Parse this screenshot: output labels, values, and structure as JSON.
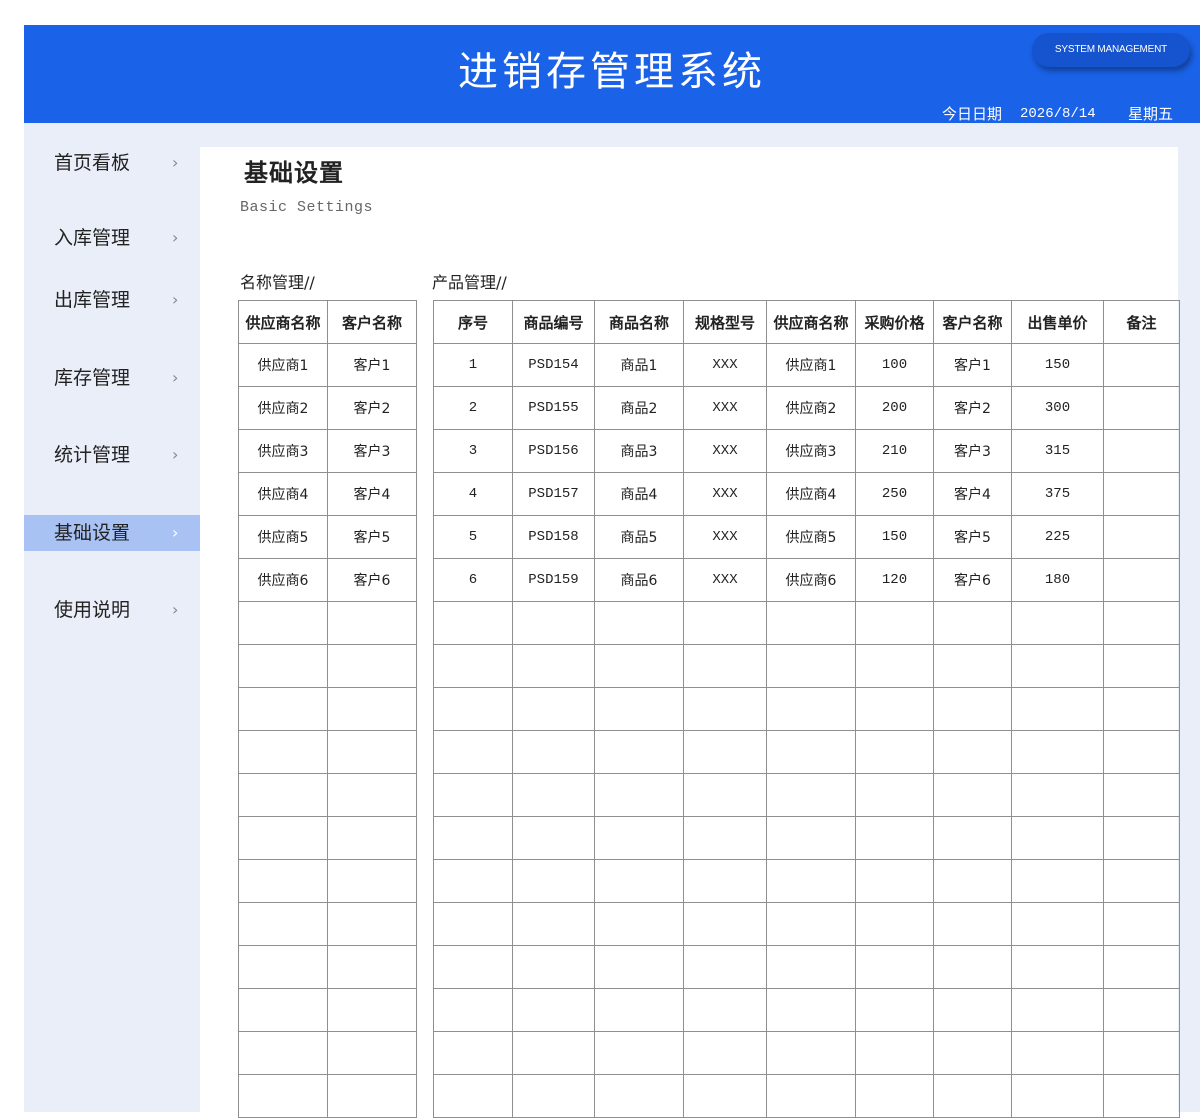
{
  "header": {
    "title": "进销存管理系统",
    "badge": "SYSTEM MANAGEMENT",
    "date_label": "今日日期",
    "date_value": "2026/8/14",
    "weekday": "星期五",
    "color": "#1a62e8"
  },
  "sidebar": {
    "items": [
      {
        "label": "首页看板",
        "icon": "chevron-right-icon",
        "active": false
      },
      {
        "label": "入库管理",
        "icon": "chevron-right-icon",
        "active": false
      },
      {
        "label": "出库管理",
        "icon": "chevron-right-icon",
        "active": false
      },
      {
        "label": "库存管理",
        "icon": "chevron-right-icon",
        "active": false
      },
      {
        "label": "统计管理",
        "icon": "chevron-right-icon",
        "active": false
      },
      {
        "label": "基础设置",
        "icon": "chevron-right-icon",
        "active": true
      },
      {
        "label": "使用说明",
        "icon": "chevron-right-icon",
        "active": false
      }
    ],
    "chevron": "›",
    "active_color": "#a9c2f4"
  },
  "page": {
    "title": "基础设置",
    "subtitle": "Basic Settings"
  },
  "names": {
    "label": "名称管理//",
    "headers": [
      "供应商名称",
      "客户名称"
    ],
    "rows": [
      [
        "供应商1",
        "客户1"
      ],
      [
        "供应商2",
        "客户2"
      ],
      [
        "供应商3",
        "客户3"
      ],
      [
        "供应商4",
        "客户4"
      ],
      [
        "供应商5",
        "客户5"
      ],
      [
        "供应商6",
        "客户6"
      ]
    ]
  },
  "products": {
    "label": "产品管理//",
    "headers": [
      "序号",
      "商品编号",
      "商品名称",
      "规格型号",
      "供应商名称",
      "采购价格",
      "客户名称",
      "出售单价",
      "备注"
    ],
    "rows": [
      [
        "1",
        "PSD154",
        "商品1",
        "XXX",
        "供应商1",
        "100",
        "客户1",
        "150",
        ""
      ],
      [
        "2",
        "PSD155",
        "商品2",
        "XXX",
        "供应商2",
        "200",
        "客户2",
        "300",
        ""
      ],
      [
        "3",
        "PSD156",
        "商品3",
        "XXX",
        "供应商3",
        "210",
        "客户3",
        "315",
        ""
      ],
      [
        "4",
        "PSD157",
        "商品4",
        "XXX",
        "供应商4",
        "250",
        "客户4",
        "375",
        ""
      ],
      [
        "5",
        "PSD158",
        "商品5",
        "XXX",
        "供应商5",
        "150",
        "客户5",
        "225",
        ""
      ],
      [
        "6",
        "PSD159",
        "商品6",
        "XXX",
        "供应商6",
        "120",
        "客户6",
        "180",
        ""
      ]
    ]
  }
}
